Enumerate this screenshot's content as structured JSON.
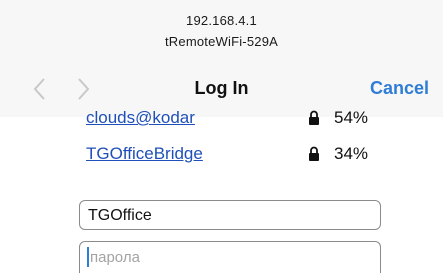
{
  "header": {
    "host": "192.168.4.1",
    "page_title": "tRemoteWiFi-529A"
  },
  "nav": {
    "back_icon": "chevron-left-icon",
    "forward_icon": "chevron-right-icon",
    "title": "Log In",
    "cancel_label": "Cancel"
  },
  "networks": [
    {
      "name": "clouds@kodar",
      "security_icon": "lock-icon",
      "signal": "54%"
    },
    {
      "name": "TGOfficeBridge",
      "security_icon": "lock-icon",
      "signal": "34%"
    }
  ],
  "form": {
    "ssid_value": "TGOffice",
    "password_placeholder": "парола"
  },
  "colors": {
    "accent": "#2f7dd6",
    "link": "#1f4fb8",
    "bar_background": "#f7f7f7"
  }
}
